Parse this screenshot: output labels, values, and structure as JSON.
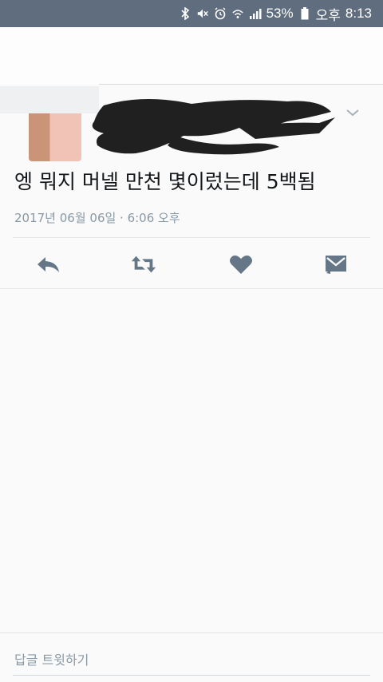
{
  "status_bar": {
    "battery_percent": "53%",
    "ampm": "오후",
    "time": "8:13",
    "icons": [
      "bluetooth-icon",
      "mute-icon",
      "alarm-icon",
      "wifi-icon",
      "signal-icon",
      "battery-icon"
    ]
  },
  "tweet": {
    "text": "엥 뭐지 머넬 만천 몇이렀는데 5백됨",
    "timestamp": "2017년 06월 06일 · 6:06 오후",
    "author_redacted": true
  },
  "actions": [
    "reply-icon",
    "retweet-icon",
    "like-icon",
    "message-icon"
  ],
  "reply": {
    "placeholder": "답글 트윗하기"
  },
  "colors": {
    "status_bar": "#5f6d7e",
    "action_icon": "#657786",
    "meta_text": "#8899a6"
  }
}
